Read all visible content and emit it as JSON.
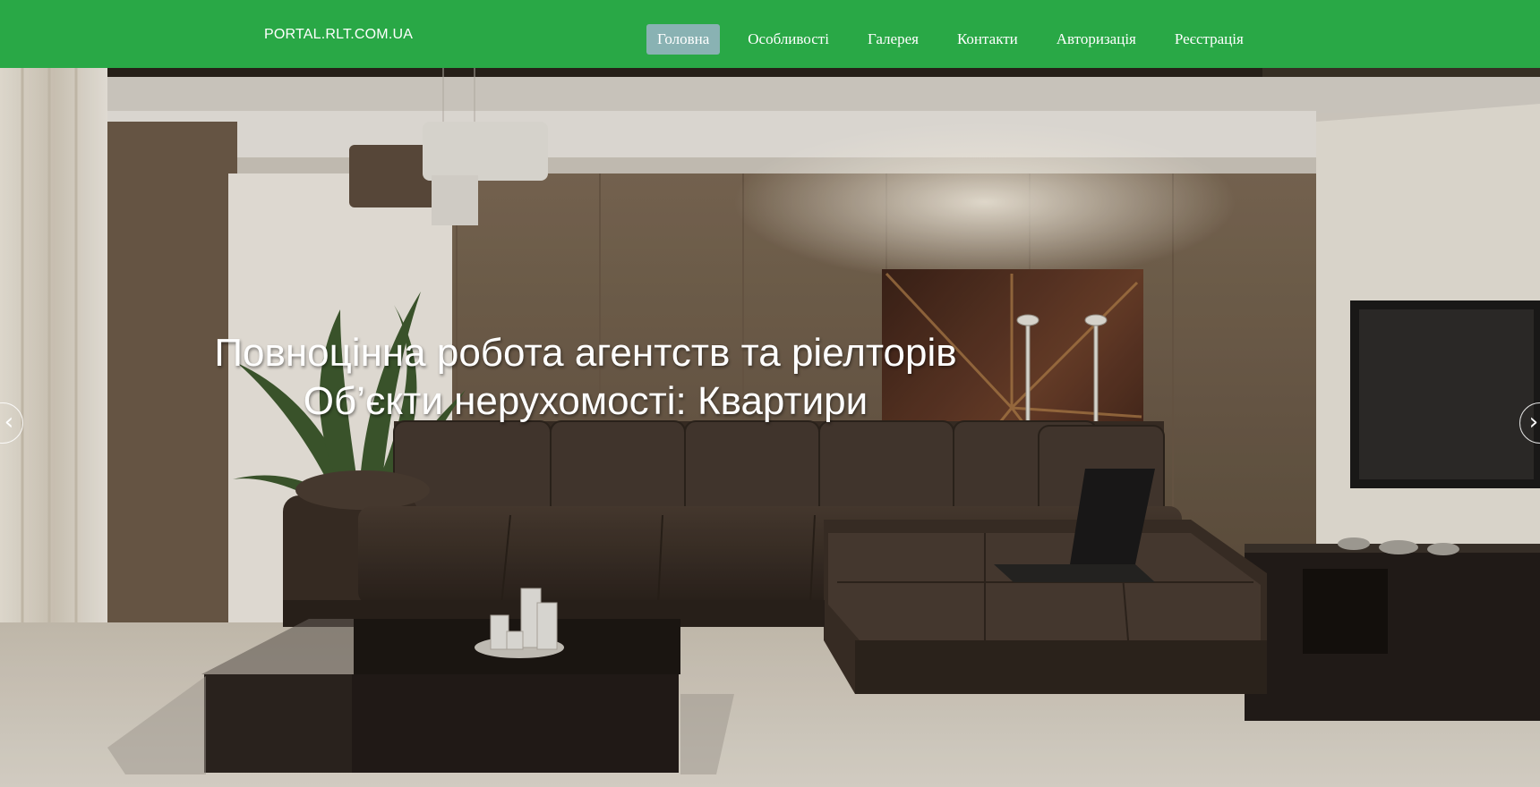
{
  "header": {
    "brand": "PORTAL.RLT.COM.UA",
    "nav": [
      {
        "label": "Головна",
        "active": true
      },
      {
        "label": "Особливості"
      },
      {
        "label": "Галерея"
      },
      {
        "label": "Контакти"
      },
      {
        "label": "Авторизація"
      },
      {
        "label": "Реєстрація"
      }
    ]
  },
  "hero": {
    "line1": "Повноцінна робота агентств та ріелторів",
    "line2": "Об’єкти нерухомості: Квартири",
    "prev_icon": "chevron-left-icon",
    "next_icon": "chevron-right-icon",
    "prev_glyph": "‹",
    "next_glyph": "›"
  },
  "colors": {
    "header_bg": "#29a846",
    "active_nav_bg": "#89b2b3",
    "nav_text": "#ffffff"
  }
}
